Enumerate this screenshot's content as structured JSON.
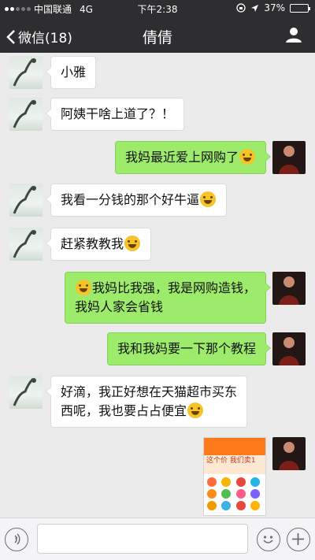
{
  "status_bar": {
    "carrier": "中国联通",
    "network": "4G",
    "time": "下午2:38",
    "battery": "37%",
    "battery_level": 0.37
  },
  "nav": {
    "back_label": "微信(18)",
    "title": "倩倩"
  },
  "messages": [
    {
      "side": "in",
      "text": "小雅"
    },
    {
      "side": "in",
      "text": "阿姨干啥上道了？！"
    },
    {
      "side": "out",
      "text": "我妈最近爱上网购了",
      "emoji_after": "face-with-tears-of-joy"
    },
    {
      "side": "in",
      "text": "我看一分钱的那个好牛逼",
      "emoji_after": "grinning-face"
    },
    {
      "side": "in",
      "text": "赶紧教教我",
      "emoji_after": "face-with-monocle"
    },
    {
      "side": "out",
      "emoji_before": "face-with-tears-of-joy",
      "line1": "我妈比我强，我是网购造钱，",
      "line2": "我妈人家会省钱"
    },
    {
      "side": "out",
      "text": "我和我妈要一下那个教程"
    },
    {
      "side": "in",
      "line1": "好滴，我正好想在天猫超市买东",
      "line2": "西呢，我也要占占便宜",
      "emoji_after": "rolling-on-floor-laughing"
    },
    {
      "side": "out",
      "type": "image",
      "image_caption": "这个价 我们卖1",
      "image_icons": [
        "#ff6b3d",
        "#f7b500",
        "#e8483b",
        "#27b3e6",
        "#ff8c1a",
        "#4fbf4f",
        "#ff5c8a",
        "#7b61ff",
        "#f29b00",
        "#3cb0e0",
        "#e8483b",
        "#ffb400"
      ]
    }
  ],
  "input": {
    "placeholder": ""
  },
  "colors": {
    "nav_bg": "#2e2e30",
    "chat_bg": "#ebebeb",
    "out_bubble": "#9deb6b",
    "in_bubble": "#ffffff"
  }
}
